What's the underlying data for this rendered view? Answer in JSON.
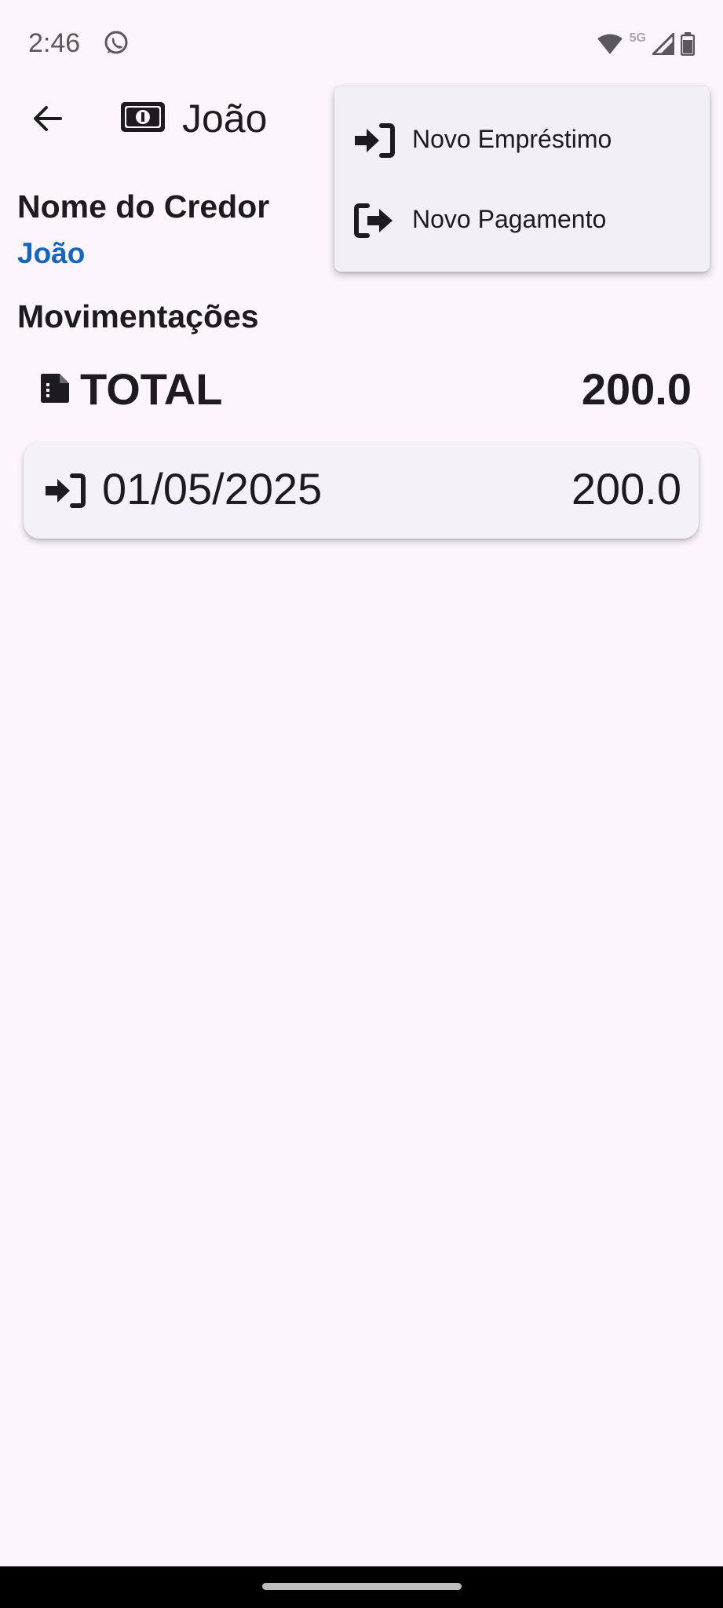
{
  "status_bar": {
    "time": "2:46",
    "network": "5G",
    "icons": [
      "whatsapp-icon",
      "wifi-icon",
      "signal-icon",
      "battery-icon"
    ]
  },
  "app_bar": {
    "title": "João",
    "back_icon": "arrow-left-icon",
    "title_icon": "money-bill-icon"
  },
  "creditor": {
    "label": "Nome do Credor",
    "value": "João"
  },
  "movements": {
    "title": "Movimentações",
    "total_label": "TOTAL",
    "total_value": "200.0",
    "items": [
      {
        "date": "01/05/2025",
        "value": "200.0",
        "icon": "sign-in-icon"
      }
    ]
  },
  "menu": {
    "items": [
      {
        "label": "Novo Empréstimo",
        "icon": "sign-in-icon"
      },
      {
        "label": "Novo Pagamento",
        "icon": "sign-out-icon"
      }
    ]
  },
  "colors": {
    "background": "#fcf6fc",
    "accent_blue": "#1565c0",
    "card": "#f5f2f7",
    "menu": "#f2eff5"
  }
}
